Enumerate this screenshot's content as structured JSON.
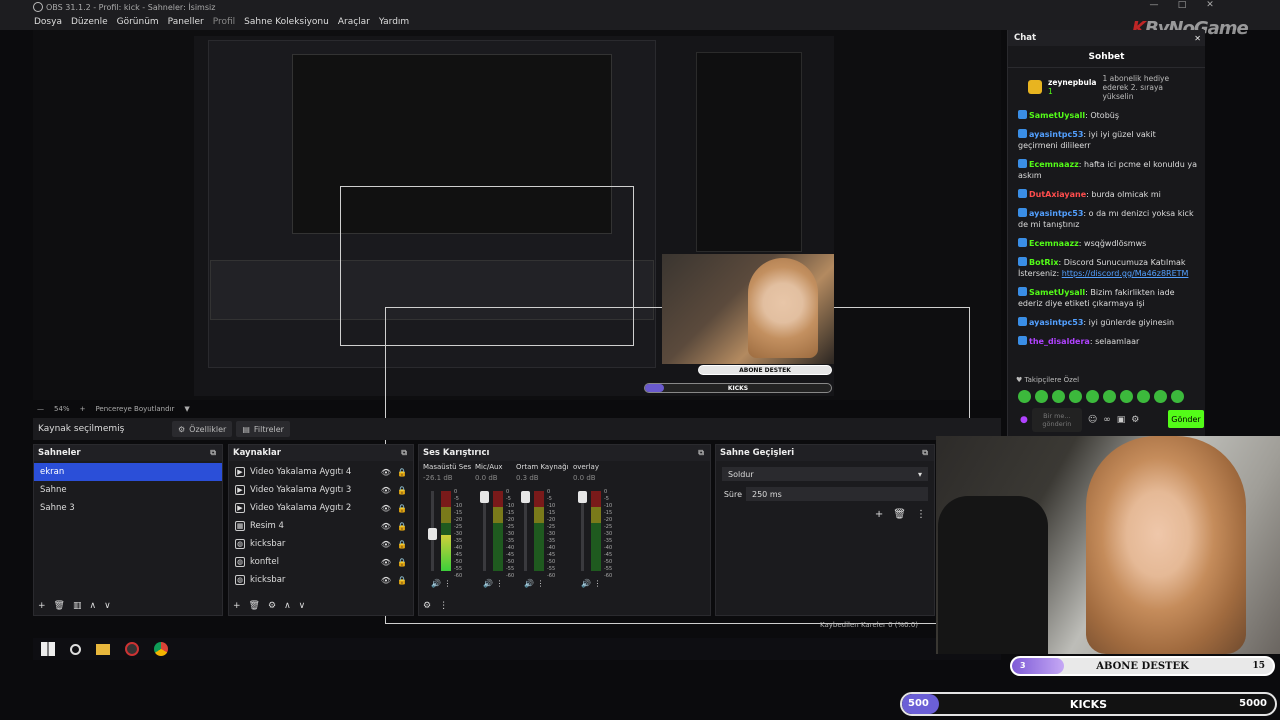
{
  "window": {
    "title": "OBS 31.1.2 - Profil: kick - Sahneler: İsimsiz"
  },
  "menu": [
    "Dosya",
    "Düzenle",
    "Görünüm",
    "Paneller",
    "Profil",
    "Sahne Koleksiyonu",
    "Araçlar",
    "Yardım"
  ],
  "preview": {
    "zoom": "54%",
    "fit_label": "Pencereye Boyutlandır"
  },
  "props_bar": {
    "no_source": "Kaynak seçilmemiş",
    "properties": "Özellikler",
    "filters": "Filtreler"
  },
  "scenes": {
    "title": "Sahneler",
    "items": [
      "ekran",
      "Sahne",
      "Sahne 3"
    ],
    "active_index": 0
  },
  "sources": {
    "title": "Kaynaklar",
    "items": [
      {
        "label": "Video Yakalama Aygıtı 4",
        "icon": "camera-icon"
      },
      {
        "label": "Video Yakalama Aygıtı 3",
        "icon": "camera-icon"
      },
      {
        "label": "Video Yakalama Aygıtı 2",
        "icon": "camera-icon"
      },
      {
        "label": "Resim 4",
        "icon": "image-icon"
      },
      {
        "label": "kicksbar",
        "icon": "globe-icon"
      },
      {
        "label": "konftel",
        "icon": "globe-icon"
      },
      {
        "label": "kicksbar",
        "icon": "globe-icon"
      }
    ]
  },
  "mixer": {
    "title": "Ses Karıştırıcı",
    "channels": [
      {
        "name": "Masaüstü Ses",
        "db": "-26.1 dB",
        "level": 0.45,
        "fader": 0.45
      },
      {
        "name": "Mic/Aux",
        "db": "0.0 dB",
        "level": 0.0,
        "fader": 1.0
      },
      {
        "name": "Ortam Kaynağı",
        "db": "0.3 dB",
        "level": 0.0,
        "fader": 1.0
      },
      {
        "name": "overlay",
        "db": "0.0 dB",
        "level": 0.0,
        "fader": 1.0
      }
    ],
    "scale": [
      "0",
      "-5",
      "-10",
      "-15",
      "-20",
      "-25",
      "-30",
      "-35",
      "-40",
      "-45",
      "-50",
      "-55",
      "-60"
    ]
  },
  "transitions": {
    "title": "Sahne Geçişleri",
    "selected": "Soldur",
    "duration_label": "Süre",
    "duration": "250 ms"
  },
  "chat": {
    "panel_title": "Chat",
    "header": "Sohbet",
    "gift": {
      "user": "zeynepbula",
      "count": "1",
      "text": "1 abonelik hediye ederek 2. sıraya yükselin"
    },
    "messages": [
      {
        "user": "SametUysall",
        "color": "#53fc18",
        "text": "Otobüş"
      },
      {
        "user": "ayasintpc53",
        "color": "#53a0ff",
        "text": "iyi iyi güzel vakit geçirmeni dilileerr"
      },
      {
        "user": "Ecemnaazz",
        "color": "#53fc18",
        "text": "hafta ici pcme el konuldu ya askım"
      },
      {
        "user": "DutAxiayane",
        "color": "#ff4d4d",
        "text": "burda olmicak mi"
      },
      {
        "user": "ayasintpc53",
        "color": "#53a0ff",
        "text": "o da mı denizci yoksa kick de mi tanıştınız"
      },
      {
        "user": "Ecemnaazz",
        "color": "#53fc18",
        "text": "wsqğwdlösmws"
      },
      {
        "user": "BotRix",
        "color": "#53fc18",
        "text": "Discord Sunucumuza Katılmak İsterseniz:",
        "link": "https://discord.gg/Ma46z8RETM"
      },
      {
        "user": "SametUysall",
        "color": "#53fc18",
        "text": "Bizim fakirlikten iade ederiz diye etiketi çıkarmaya işi"
      },
      {
        "user": "ayasintpc53",
        "color": "#53a0ff",
        "text": "iyi günlerde giyinesin"
      },
      {
        "user": "the_disaldera",
        "color": "#b042ff",
        "text": "selaamlaar"
      }
    ],
    "follow_label": "Takipçilere Özel",
    "input_placeholder": "Bir me... gönderin",
    "send_label": "Gönder"
  },
  "overlays": {
    "abone": {
      "label": "ABONE DESTEK",
      "current": "3",
      "goal": "15",
      "progress": 0.2
    },
    "kicks": {
      "label": "KICKS",
      "current": "500",
      "goal": "5000",
      "progress": 0.1
    }
  },
  "status": {
    "dropped_frames": "Kaybedilen Kareler 0 (%0.0)"
  },
  "watermark": {
    "brand_k": "K",
    "brand_text": "ByNoGame"
  },
  "colors": {
    "accent": "#2b4fd8",
    "kick_green": "#53fc18",
    "progress_purple": "#6b5fd6"
  }
}
